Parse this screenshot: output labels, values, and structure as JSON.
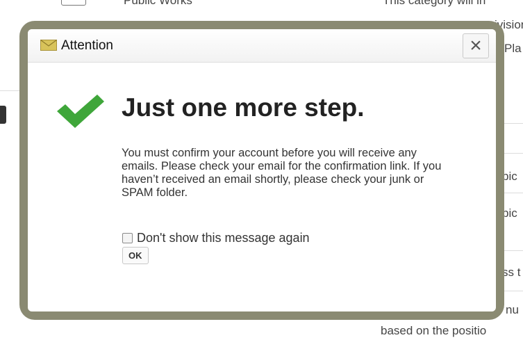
{
  "background": {
    "top_left_label": "Public Works",
    "top_right_text": "This category will in",
    "right_fragments": [
      "ivision",
      "Pla",
      "pic",
      "pic",
      "ss t",
      "nu"
    ],
    "bottom_text": "based on the positio"
  },
  "dialog": {
    "title": "Attention",
    "title_icon": "envelope-icon",
    "close_label": "×",
    "headline_icon": "check-icon",
    "headline": "Just one more step.",
    "message": "You must confirm your account before you will receive any emails. Please check your email for the confirmation link. If you haven’t received an email shortly, please check your junk or SPAM folder.",
    "checkbox_label": "Don't show this message again",
    "ok_label": "OK"
  },
  "colors": {
    "frame": "#8a8a72",
    "check_green": "#3fa63a",
    "envelope": "#d8c35a"
  }
}
